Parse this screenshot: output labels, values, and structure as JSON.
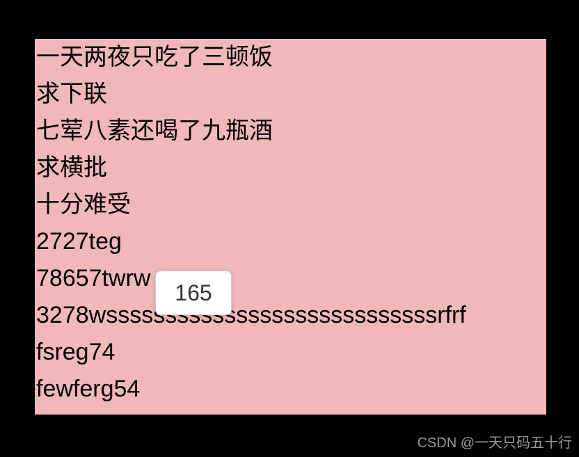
{
  "lines": {
    "l0": "一天两夜只吃了三顿饭",
    "l1": "求下联",
    "l2": "七荤八素还喝了九瓶酒",
    "l3": "求横批",
    "l4": "十分难受",
    "l5": "2727teg",
    "l6": "78657twrw",
    "l7": "3278wssssssssssssssssssssssssssssrfrf",
    "l8": "fsreg74",
    "l9": "fewferg54"
  },
  "tooltip": {
    "value": "165"
  },
  "watermark": {
    "text": "CSDN @一天只码五十行"
  }
}
